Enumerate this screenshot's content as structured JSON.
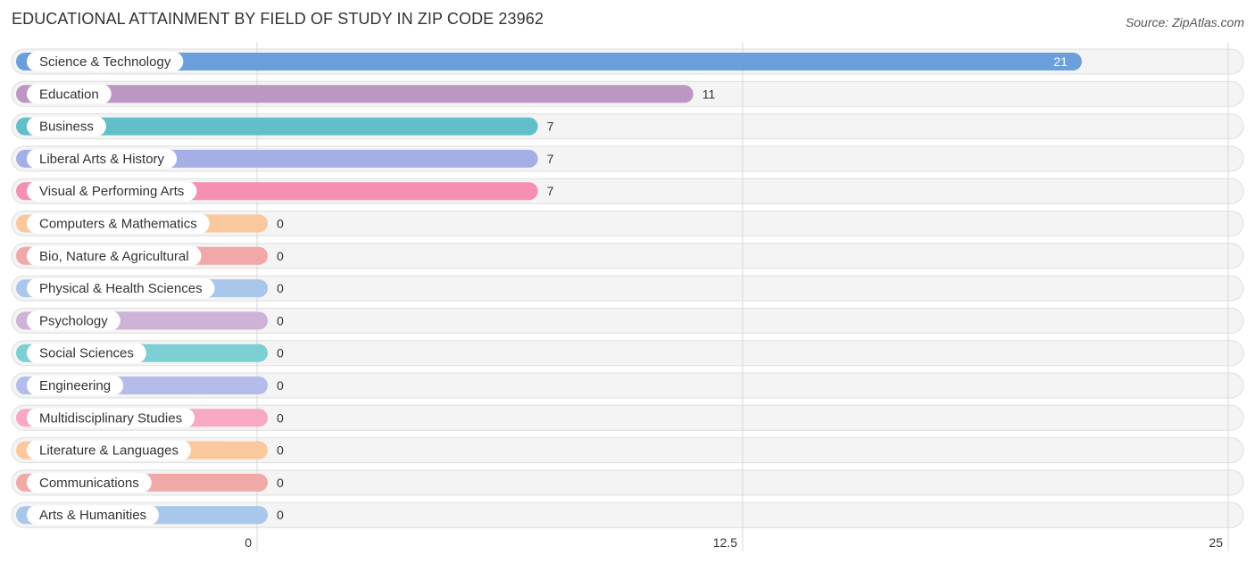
{
  "chart_data": {
    "type": "bar",
    "orientation": "horizontal",
    "title": "EDUCATIONAL ATTAINMENT BY FIELD OF STUDY IN ZIP CODE 23962",
    "source": "Source: ZipAtlas.com",
    "xlabel": "",
    "ylabel": "",
    "xlim": [
      0,
      25
    ],
    "ticks": [
      0,
      12.5,
      25
    ],
    "tick_labels": [
      "0",
      "12.5",
      "25"
    ],
    "grid": true,
    "categories": [
      "Science & Technology",
      "Education",
      "Business",
      "Liberal Arts & History",
      "Visual & Performing Arts",
      "Computers & Mathematics",
      "Bio, Nature & Agricultural",
      "Physical & Health Sciences",
      "Psychology",
      "Social Sciences",
      "Engineering",
      "Multidisciplinary Studies",
      "Literature & Languages",
      "Communications",
      "Arts & Humanities"
    ],
    "values": [
      21,
      11,
      7,
      7,
      7,
      0,
      0,
      0,
      0,
      0,
      0,
      0,
      0,
      0,
      0
    ],
    "colors": [
      "#6a9fdc",
      "#bd97c4",
      "#62bfca",
      "#a5afe6",
      "#f590b2",
      "#fac89d",
      "#f0a8a8",
      "#a9c6eb",
      "#cfb3d6",
      "#7ccfd2",
      "#b4bcec",
      "#f6a8c4",
      "#fac89d",
      "#f0aaa8",
      "#a9c6eb"
    ]
  }
}
